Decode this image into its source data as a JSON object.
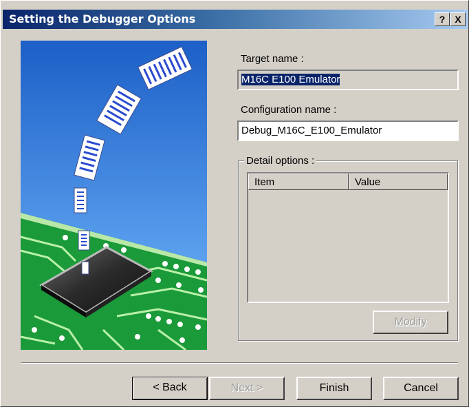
{
  "window": {
    "title": "Setting the Debugger Options",
    "help_glyph": "?",
    "close_glyph": "X"
  },
  "form": {
    "target_label": "Target name :",
    "target_value": "M16C E100 Emulator",
    "config_label": "Configuration name :",
    "config_value": "Debug_M16C_E100_Emulator",
    "detail_label": "Detail options :",
    "columns": [
      "Item",
      "Value"
    ],
    "modify_label": "Modify"
  },
  "buttons": {
    "back": "< Back",
    "next": "Next >",
    "finish": "Finish",
    "cancel": "Cancel"
  },
  "colors": {
    "titlebar_start": "#0a246a",
    "selection": "#0a246a",
    "dialog_bg": "#d4d0c8",
    "sky": "#3b7fd9",
    "board": "#1b9a3a"
  }
}
